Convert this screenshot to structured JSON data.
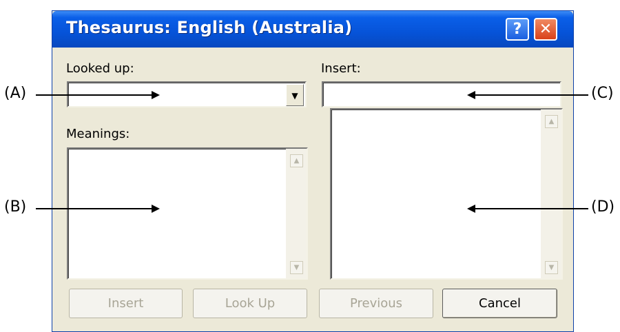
{
  "window": {
    "title": "Thesaurus: English (Australia)"
  },
  "titlebar": {
    "help_glyph": "?",
    "close_glyph": "✕"
  },
  "labels": {
    "looked_up": "Looked up:",
    "meanings": "Meanings:",
    "insert": "Insert:"
  },
  "fields": {
    "looked_up_value": "",
    "insert_value": ""
  },
  "buttons": {
    "insert": {
      "label": "Insert",
      "enabled": false
    },
    "look_up": {
      "label": "Look Up",
      "enabled": false
    },
    "previous": {
      "label": "Previous",
      "enabled": false
    },
    "cancel": {
      "label": "Cancel",
      "enabled": true
    }
  },
  "icons": {
    "dropdown": "chevron-down-icon",
    "scroll_up": "scroll-up-icon",
    "scroll_down": "scroll-down-icon"
  },
  "callouts": {
    "a": "(A)",
    "b": "(B)",
    "c": "(C)",
    "d": "(D)"
  }
}
